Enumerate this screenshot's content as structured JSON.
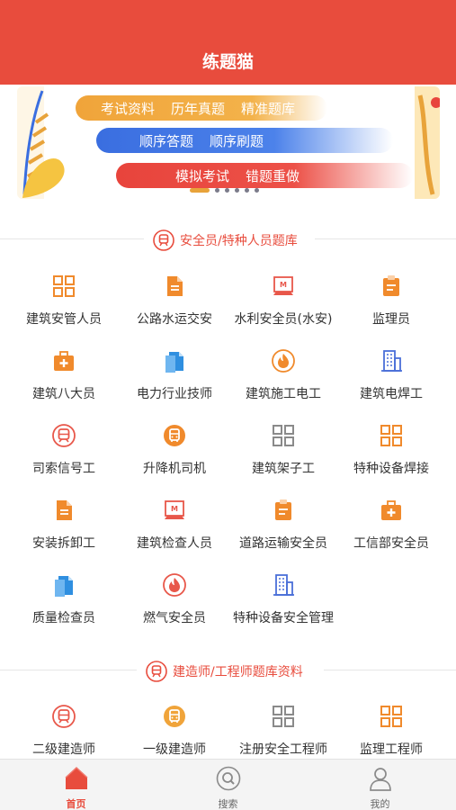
{
  "header": {
    "title": "练题猫"
  },
  "banner": {
    "row1": [
      "考试资料",
      "历年真题",
      "精准题库"
    ],
    "row2": [
      "顺序答题",
      "顺序刷题"
    ],
    "row3": [
      "模拟考试",
      "错题重做"
    ],
    "colors": {
      "orange": "#f0a43a",
      "blue": "#3a6ee0",
      "red": "#e8443c"
    }
  },
  "section1": {
    "title": "安全员/特种人员题库",
    "items": [
      {
        "label": "建筑安管人员",
        "icon": "grid-icon"
      },
      {
        "label": "公路水运交安",
        "icon": "document-icon"
      },
      {
        "label": "水利安全员(水安)",
        "icon": "certificate-icon"
      },
      {
        "label": "监理员",
        "icon": "clipboard-icon"
      },
      {
        "label": "建筑八大员",
        "icon": "medical-kit-icon"
      },
      {
        "label": "电力行业技师",
        "icon": "files-icon"
      },
      {
        "label": "建筑施工电工",
        "icon": "fire-badge-icon"
      },
      {
        "label": "建筑电焊工",
        "icon": "building-icon"
      },
      {
        "label": "司索信号工",
        "icon": "train-badge-icon"
      },
      {
        "label": "升降机司机",
        "icon": "bus-badge-icon"
      },
      {
        "label": "建筑架子工",
        "icon": "grid-icon"
      },
      {
        "label": "特种设备焊接",
        "icon": "grid-icon"
      },
      {
        "label": "安装拆卸工",
        "icon": "document-icon"
      },
      {
        "label": "建筑检查人员",
        "icon": "certificate-icon"
      },
      {
        "label": "道路运输安全员",
        "icon": "clipboard-icon"
      },
      {
        "label": "工信部安全员",
        "icon": "medical-kit-icon"
      },
      {
        "label": "质量检查员",
        "icon": "files-icon"
      },
      {
        "label": "燃气安全员",
        "icon": "fire-badge-icon"
      },
      {
        "label": "特种设备安全管理",
        "icon": "building-icon"
      }
    ]
  },
  "section2": {
    "title": "建造师/工程师题库资料",
    "items": [
      {
        "label": "二级建造师",
        "icon": "train-badge-icon"
      },
      {
        "label": "一级建造师",
        "icon": "bus-badge-icon"
      },
      {
        "label": "注册安全工程师",
        "icon": "grid-icon"
      },
      {
        "label": "监理工程师",
        "icon": "grid-icon"
      }
    ]
  },
  "tabbar": {
    "items": [
      {
        "label": "首页",
        "icon": "home-icon",
        "active": true
      },
      {
        "label": "搜索",
        "icon": "search-icon",
        "active": false
      },
      {
        "label": "我的",
        "icon": "user-icon",
        "active": false
      }
    ],
    "active_color": "#e84c3d"
  }
}
